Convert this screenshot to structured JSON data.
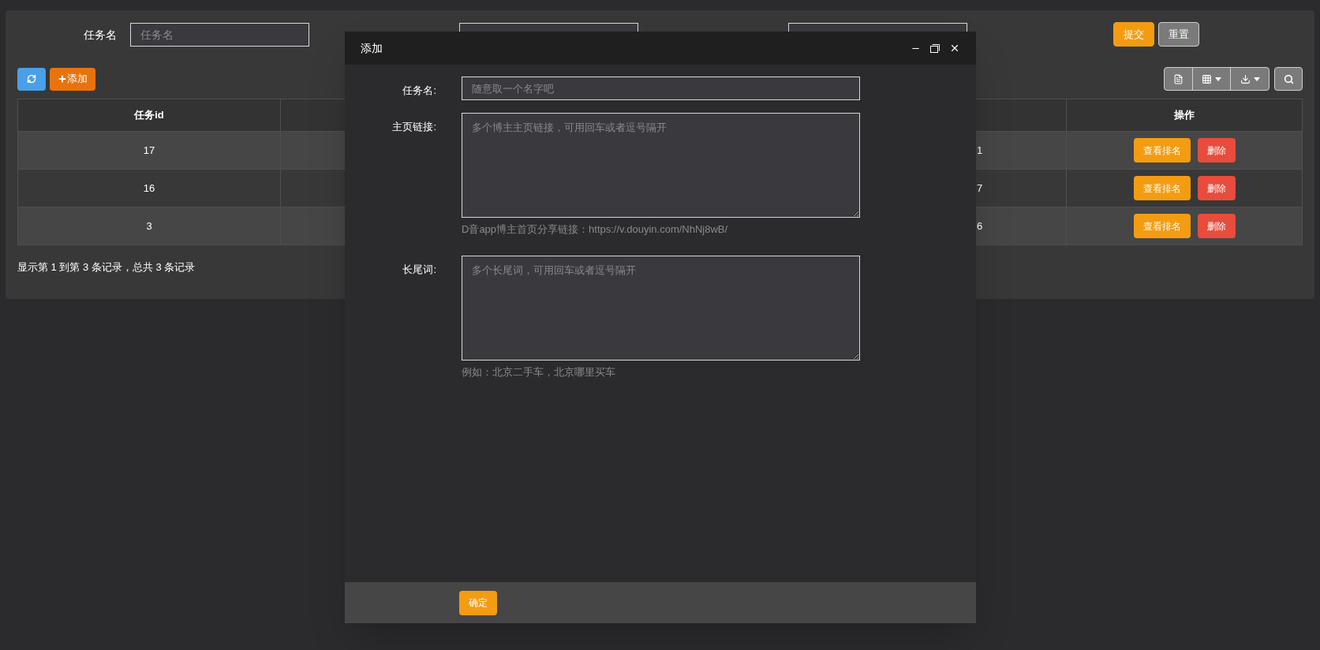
{
  "filter_form": {
    "fields": [
      {
        "label": "任务名",
        "placeholder": "任务名"
      }
    ],
    "buttons": [
      {
        "kind": "primary",
        "label": "提交"
      },
      {
        "kind": "default",
        "label": "重置"
      }
    ]
  },
  "toolbar": {
    "add_label": "添加"
  },
  "table": {
    "columns": [
      "任务id",
      "操作"
    ],
    "rows": [
      {
        "id": "17",
        "column_3": "1",
        "actions": [
          {
            "kind": "warning",
            "label": "查看排名"
          },
          {
            "kind": "danger",
            "label": "删除"
          }
        ]
      },
      {
        "id": "16",
        "column_3": "7",
        "actions": [
          {
            "kind": "warning",
            "label": "查看排名"
          },
          {
            "kind": "danger",
            "label": "删除"
          }
        ]
      },
      {
        "id": "3",
        "column_3": "6",
        "actions": [
          {
            "kind": "warning",
            "label": "查看排名"
          },
          {
            "kind": "danger",
            "label": "删除"
          }
        ]
      }
    ]
  },
  "pagination_text": "显示第 1 到第 3 条记录，总共 3 条记录",
  "modal": {
    "title": "添加",
    "fields": [
      {
        "kind": "input",
        "label": "任务名:",
        "placeholder": "随意取一个名字吧"
      },
      {
        "kind": "textarea",
        "label": "主页链接:",
        "placeholder": "多个博主主页链接，可用回车或者逗号隔开",
        "help": "D音app博主首页分享链接：https://v.douyin.com/NhNj8wB/"
      },
      {
        "kind": "textarea",
        "label": "长尾词:",
        "placeholder": "多个长尾词，可用回车或者逗号隔开",
        "help": "例如：北京二手车，北京哪里买车"
      }
    ],
    "submit_label": "确定"
  }
}
